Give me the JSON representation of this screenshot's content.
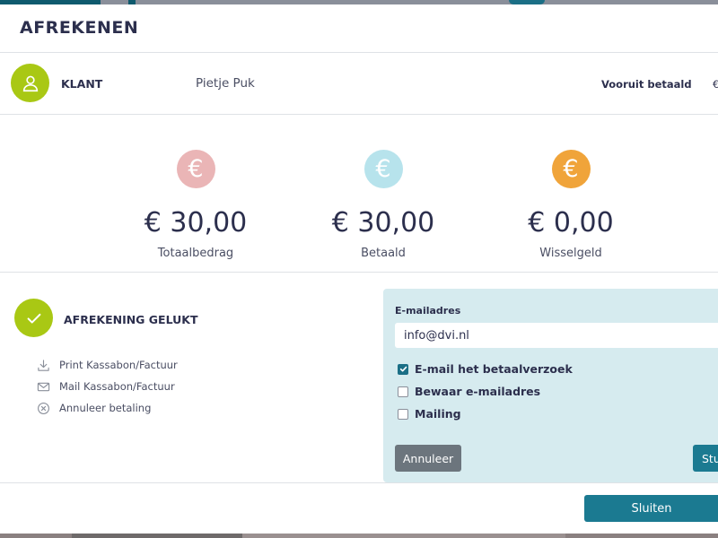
{
  "dialog": {
    "title": "AFREKENEN"
  },
  "client": {
    "label": "KLANT",
    "name": "Pietje Puk",
    "prepaid_label": "Vooruit betaald",
    "prepaid_value": "€"
  },
  "stats": [
    {
      "currency_symbol": "€",
      "amount": "€ 30,00",
      "label": "Totaalbedrag",
      "color": "#eab5b6"
    },
    {
      "currency_symbol": "€",
      "amount": "€ 30,00",
      "label": "Betaald",
      "color": "#b7e3ec"
    },
    {
      "currency_symbol": "€",
      "amount": "€ 0,00",
      "label": "Wisselgeld",
      "color": "#f0a43a"
    }
  ],
  "status": {
    "label": "AFREKENING GELUKT"
  },
  "actions": [
    {
      "icon": "download-icon",
      "label": "Print Kassabon/Factuur"
    },
    {
      "icon": "mail-icon",
      "label": "Mail Kassabon/Factuur"
    },
    {
      "icon": "cancel-circle-icon",
      "label": "Annuleer betaling"
    }
  ],
  "mail_panel": {
    "email_label": "E-mailadres",
    "email_value": "info@dvi.nl",
    "checkboxes": [
      {
        "label": "E-mail het betaalverzoek",
        "checked": true
      },
      {
        "label": "Bewaar e-mailadres",
        "checked": false
      },
      {
        "label": "Mailing",
        "checked": false
      }
    ],
    "cancel_label": "Annuleer",
    "send_label": "Stu"
  },
  "footer": {
    "close_label": "Sluiten"
  },
  "colors": {
    "accent": "#1b7a91",
    "success": "#a9c814",
    "panel": "#d6ebef"
  }
}
